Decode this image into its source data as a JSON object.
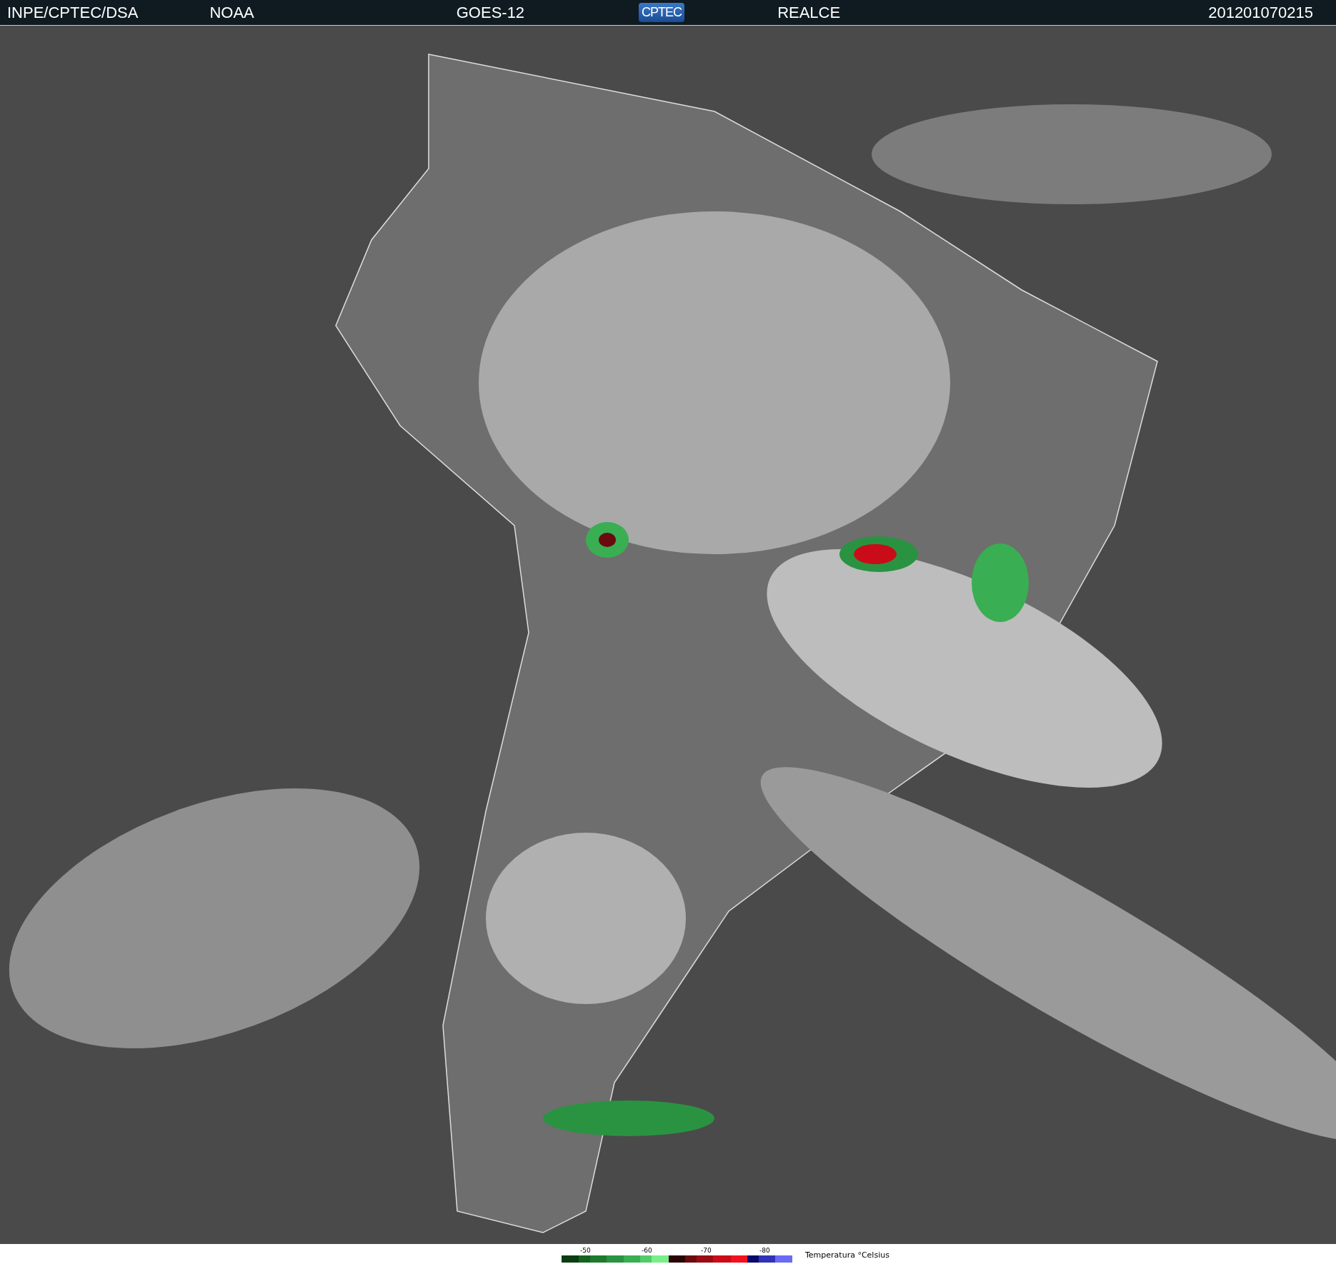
{
  "header": {
    "source": "INPE/CPTEC/DSA",
    "agency": "NOAA",
    "satellite": "GOES-12",
    "logo": "CPTEC",
    "product": "REALCE",
    "timestamp": "201201070215"
  },
  "legend": {
    "ticks": [
      "-50",
      "-60",
      "-70",
      "-80"
    ],
    "swatches": [
      {
        "color": "#0a3d12"
      },
      {
        "color": "#15621f"
      },
      {
        "color": "#1f7a2c"
      },
      {
        "color": "#2a9341"
      },
      {
        "color": "#3aae52"
      },
      {
        "color": "#52cc6a"
      },
      {
        "color": "#78ee88"
      },
      {
        "color": "#2a0508"
      },
      {
        "color": "#6a0a10"
      },
      {
        "color": "#9a0c14"
      },
      {
        "color": "#c90c18"
      },
      {
        "color": "#f5101e"
      },
      {
        "color": "#0a0a6a"
      },
      {
        "color": "#3232b8"
      },
      {
        "color": "#6a6af5"
      }
    ],
    "label": "Temperatura °Celsius"
  }
}
